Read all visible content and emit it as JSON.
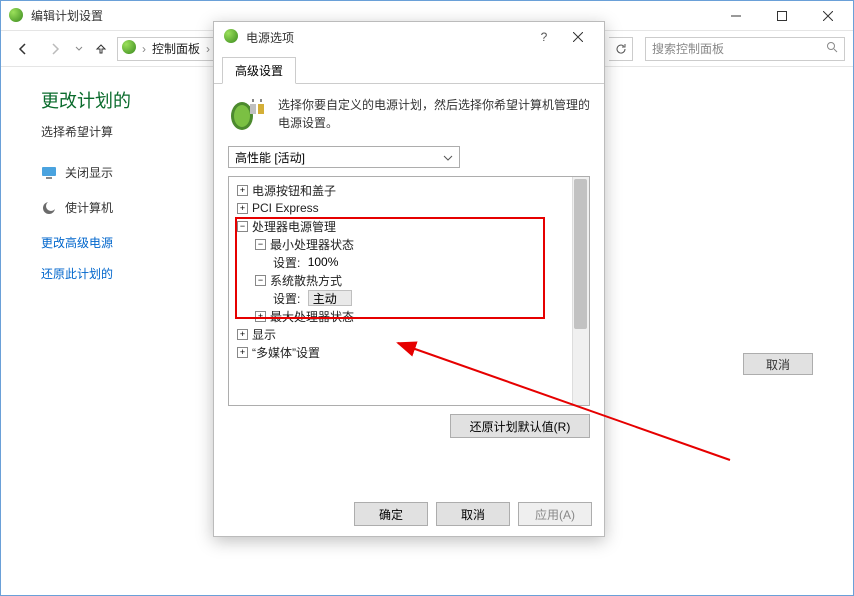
{
  "outer": {
    "title": "编辑计划设置",
    "breadcrumb": "控制面板",
    "search_placeholder": "搜索控制面板",
    "page_title": "更改计划的",
    "page_desc": "选择希望计算",
    "row_turnoff": "关闭显示",
    "row_sleep": "使计算机",
    "link_advanced": "更改高级电源",
    "link_restore": "还原此计划的",
    "footer_cancel": "取消"
  },
  "dialog": {
    "title": "电源选项",
    "tab_label": "高级设置",
    "desc": "选择你要自定义的电源计划，然后选择你希望计算机管理的电源设置。",
    "plan_selected": "高性能 [活动]",
    "tree": {
      "n0": "电源按钮和盖子",
      "n1": "PCI Express",
      "n2": "处理器电源管理",
      "n2_0": "最小处理器状态",
      "n2_0_set_label": "设置:",
      "n2_0_set_value": "100%",
      "n2_1": "系统散热方式",
      "n2_1_set_label": "设置:",
      "n2_1_set_value": "主动",
      "n2_2": "最大处理器状态",
      "n3": "显示",
      "n4": "“多媒体”设置"
    },
    "restore_defaults": "还原计划默认值(R)",
    "ok": "确定",
    "cancel": "取消",
    "apply": "应用(A)"
  }
}
